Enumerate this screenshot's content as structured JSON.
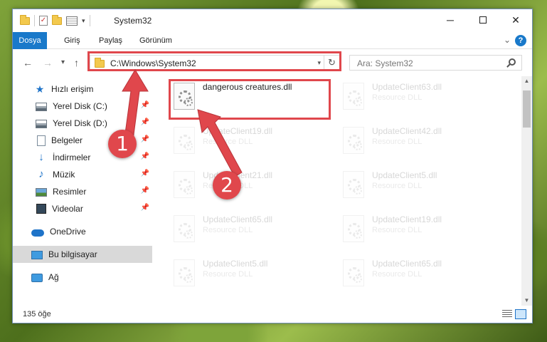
{
  "window": {
    "title": "System32"
  },
  "quick_access_icons": [
    "folder-icon",
    "properties-check-icon",
    "new-folder-icon",
    "properties-icon"
  ],
  "window_controls": {
    "minimize": "─",
    "maximize": "",
    "close": "✕"
  },
  "ribbon": {
    "tabs": [
      "Dosya",
      "Giriş",
      "Paylaş",
      "Görünüm"
    ],
    "help": "?"
  },
  "address_bar": {
    "path": "C:\\Windows\\System32",
    "dropdown": "▾",
    "refresh": "↻"
  },
  "search": {
    "placeholder": "Ara: System32"
  },
  "nav_buttons": {
    "back": "←",
    "forward": "→",
    "recent": "▾",
    "up": "↑"
  },
  "sidebar": {
    "items": [
      {
        "label": "Hızlı erişim",
        "icon": "star-icon",
        "pinned": false
      },
      {
        "label": "Yerel Disk (C:)",
        "icon": "drive-icon",
        "pinned": true
      },
      {
        "label": "Yerel Disk (D:)",
        "icon": "drive-icon",
        "pinned": true
      },
      {
        "label": "Belgeler",
        "icon": "documents-icon",
        "pinned": true
      },
      {
        "label": "İndirmeler",
        "icon": "download-icon",
        "pinned": true
      },
      {
        "label": "Müzik",
        "icon": "music-icon",
        "pinned": true
      },
      {
        "label": "Resimler",
        "icon": "pictures-icon",
        "pinned": true
      },
      {
        "label": "Videolar",
        "icon": "videos-icon",
        "pinned": true
      },
      {
        "label": "OneDrive",
        "icon": "onedrive-icon",
        "pinned": false
      },
      {
        "label": "Bu bilgisayar",
        "icon": "this-pc-icon",
        "pinned": false,
        "selected": true
      },
      {
        "label": "Ağ",
        "icon": "network-icon",
        "pinned": false
      }
    ],
    "pin_glyph": "📌"
  },
  "files": [
    {
      "name": "dangerous creatures.dll",
      "type": "",
      "faded": false
    },
    {
      "name": "UpdateClient63.dll",
      "type": "Resource DLL",
      "faded": true
    },
    {
      "name": "UpdateClient19.dll",
      "type": "Resource DLL",
      "faded": true
    },
    {
      "name": "UpdateClient42.dll",
      "type": "Resource DLL",
      "faded": true
    },
    {
      "name": "UpdateClient21.dll",
      "type": "Resource DLL",
      "faded": true
    },
    {
      "name": "UpdateClient5.dll",
      "type": "Resource DLL",
      "faded": true
    },
    {
      "name": "UpdateClient65.dll",
      "type": "Resource DLL",
      "faded": true
    },
    {
      "name": "UpdateClient19.dll",
      "type": "Resource DLL",
      "faded": true
    },
    {
      "name": "UpdateClient5.dll",
      "type": "Resource DLL",
      "faded": true
    },
    {
      "name": "UpdateClient65.dll",
      "type": "Resource DLL",
      "faded": true
    }
  ],
  "status": {
    "item_count": "135 öğe"
  },
  "annotations": {
    "step1": "1",
    "step2": "2",
    "highlight_color": "#e0474c"
  },
  "colors": {
    "accent": "#1979ca",
    "selected_bg": "#d9d9d9"
  }
}
